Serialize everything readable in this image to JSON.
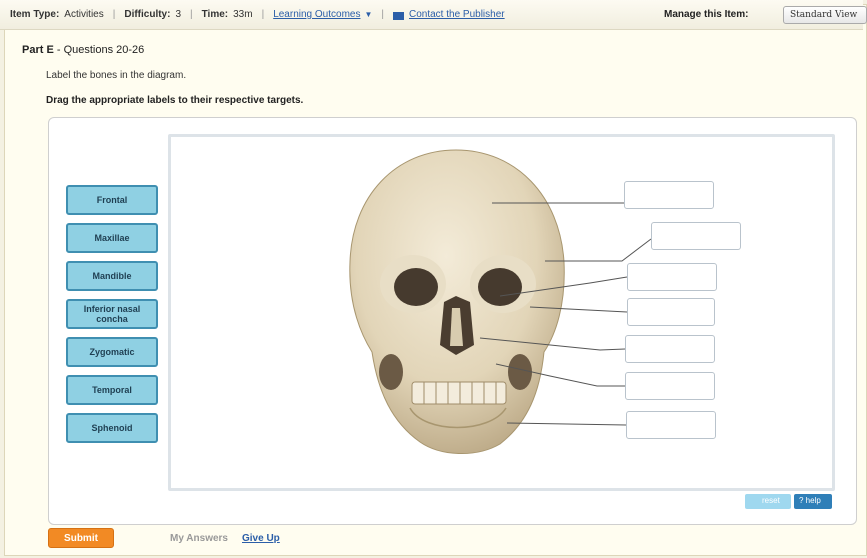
{
  "topbar": {
    "item_type_label": "Item Type:",
    "item_type_value": "Activities",
    "difficulty_label": "Difficulty:",
    "difficulty_value": "3",
    "time_label": "Time:",
    "time_value": "33m",
    "learning_outcomes": "Learning Outcomes",
    "contact_publisher": "Contact the Publisher",
    "manage_label": "Manage this Item:",
    "standard_view": "Standard View"
  },
  "part": {
    "prefix": "Part E",
    "title": "Questions 20-26"
  },
  "instructions": {
    "line1": "Label the bones in the diagram.",
    "line2": "Drag the appropriate labels to their respective targets."
  },
  "labels": [
    "Frontal",
    "Maxillae",
    "Mandible",
    "Inferior nasal concha",
    "Zygomatic",
    "Temporal",
    "Sphenoid"
  ],
  "controls": {
    "reset": "reset",
    "help": "? help",
    "submit": "Submit",
    "my_answers": "My Answers",
    "give_up": "Give Up"
  },
  "colors": {
    "label_fill": "#8fd0e3",
    "label_border": "#3f8fb1",
    "submit": "#f28a24",
    "link": "#2b5ea8"
  }
}
